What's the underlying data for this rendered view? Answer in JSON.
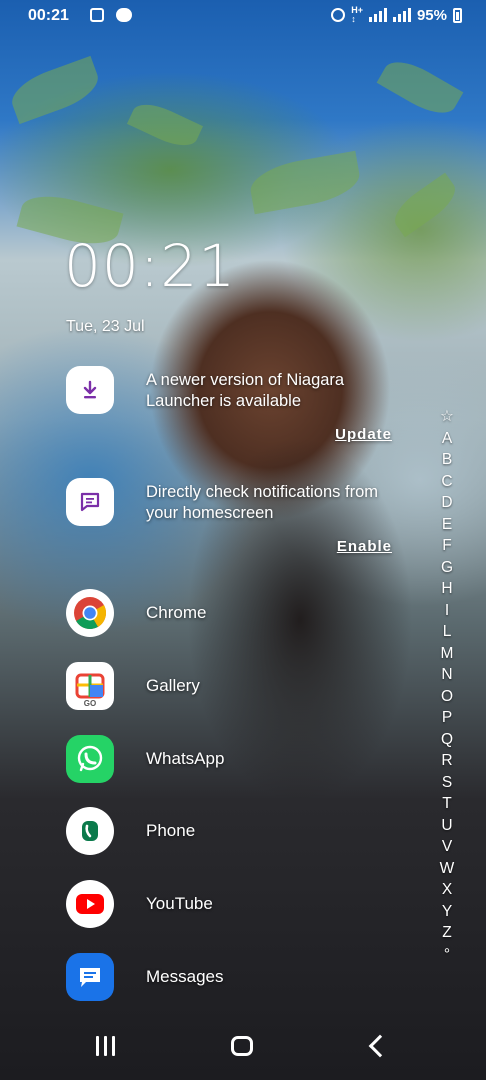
{
  "status_bar": {
    "time": "00:21",
    "battery": "95%",
    "left_icons": [
      "vpn-icon",
      "chat-icon"
    ],
    "right_icons": [
      "alarm-icon",
      "lte-icon",
      "signal-icon",
      "signal-icon",
      "battery-charging-icon"
    ]
  },
  "lockscreen": {
    "clock": "00:21",
    "date": "Tue, 23 Jul"
  },
  "notifications": [
    {
      "icon": "download-icon",
      "text": "A newer version of Niagara Launcher is available",
      "action": "Update"
    },
    {
      "icon": "message-icon",
      "text": "Directly check notifications from your homescreen",
      "action": "Enable"
    }
  ],
  "apps": [
    {
      "label": "Chrome",
      "icon": "chrome-icon"
    },
    {
      "label": "Gallery",
      "icon": "gallery-icon",
      "badge": "GO"
    },
    {
      "label": "WhatsApp",
      "icon": "whatsapp-icon"
    },
    {
      "label": "Phone",
      "icon": "phone-icon"
    },
    {
      "label": "YouTube",
      "icon": "youtube-icon"
    },
    {
      "label": "Messages",
      "icon": "messages-icon"
    }
  ],
  "alphabet_index": [
    "☆",
    "A",
    "B",
    "C",
    "D",
    "E",
    "F",
    "G",
    "H",
    "I",
    "L",
    "M",
    "N",
    "O",
    "P",
    "Q",
    "R",
    "S",
    "T",
    "U",
    "V",
    "W",
    "X",
    "Y",
    "Z",
    "°"
  ],
  "nav_bar": {
    "icons": [
      "recent-apps-icon",
      "home-icon",
      "back-icon"
    ]
  },
  "colors": {
    "accent_purple": "#7b2fa8",
    "whatsapp_green": "#25d366",
    "phone_green": "#0b7a4b",
    "youtube_red": "#ff0000",
    "messages_blue": "#1a73e8"
  }
}
